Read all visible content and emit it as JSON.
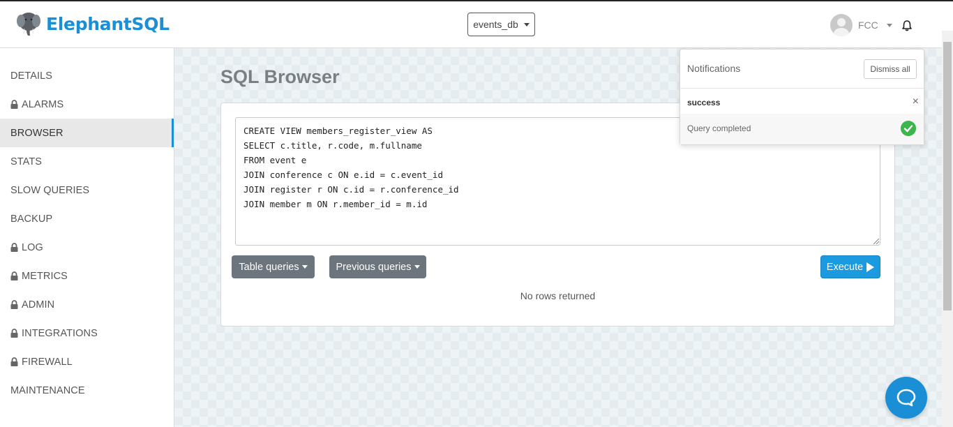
{
  "header": {
    "brand": "ElephantSQL",
    "database": "events_db",
    "user": "FCC"
  },
  "sidebar": {
    "items": [
      {
        "label": "DETAILS",
        "locked": false,
        "active": false
      },
      {
        "label": "ALARMS",
        "locked": true,
        "active": false
      },
      {
        "label": "BROWSER",
        "locked": false,
        "active": true
      },
      {
        "label": "STATS",
        "locked": false,
        "active": false
      },
      {
        "label": "SLOW QUERIES",
        "locked": false,
        "active": false
      },
      {
        "label": "BACKUP",
        "locked": false,
        "active": false
      },
      {
        "label": "LOG",
        "locked": true,
        "active": false
      },
      {
        "label": "METRICS",
        "locked": true,
        "active": false
      },
      {
        "label": "ADMIN",
        "locked": true,
        "active": false
      },
      {
        "label": "INTEGRATIONS",
        "locked": true,
        "active": false
      },
      {
        "label": "FIREWALL",
        "locked": true,
        "active": false
      },
      {
        "label": "MAINTENANCE",
        "locked": false,
        "active": false
      }
    ]
  },
  "main": {
    "title": "SQL Browser",
    "query": "CREATE VIEW members_register_view AS\nSELECT c.title, r.code, m.fullname\nFROM event e\nJOIN conference c ON e.id = c.event_id\nJOIN register r ON c.id = r.conference_id\nJOIN member m ON r.member_id = m.id",
    "table_queries_label": "Table queries",
    "previous_queries_label": "Previous queries",
    "execute_label": "Execute",
    "result_text": "No rows returned"
  },
  "notifications": {
    "title": "Notifications",
    "dismiss_label": "Dismiss all",
    "items": [
      {
        "type": "success",
        "message": "Query completed"
      }
    ]
  },
  "colors": {
    "accent": "#1b8fd6",
    "success": "#3cb64a",
    "button_dark": "#6c757d"
  }
}
